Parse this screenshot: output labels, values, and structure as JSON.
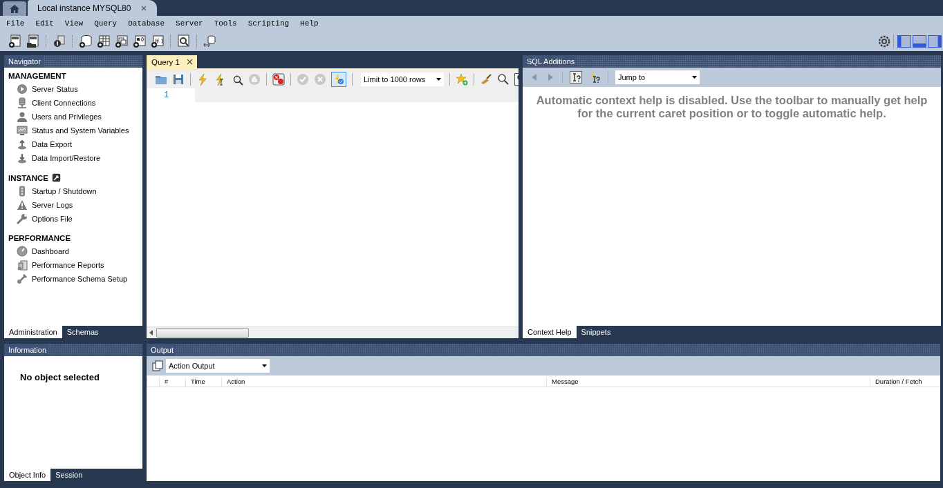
{
  "connection_tabs": [
    {
      "label": "Local instance MYSQL80",
      "selected": true
    }
  ],
  "menu": [
    "File",
    "Edit",
    "View",
    "Query",
    "Database",
    "Server",
    "Tools",
    "Scripting",
    "Help"
  ],
  "navigator": {
    "title": "Navigator",
    "sections": [
      {
        "heading": "MANAGEMENT",
        "items": [
          "Server Status",
          "Client Connections",
          "Users and Privileges",
          "Status and System Variables",
          "Data Export",
          "Data Import/Restore"
        ]
      },
      {
        "heading": "INSTANCE",
        "items": [
          "Startup / Shutdown",
          "Server Logs",
          "Options File"
        ]
      },
      {
        "heading": "PERFORMANCE",
        "items": [
          "Dashboard",
          "Performance Reports",
          "Performance Schema Setup"
        ]
      }
    ],
    "tabs": [
      {
        "label": "Administration",
        "selected": true
      },
      {
        "label": "Schemas",
        "selected": false
      }
    ]
  },
  "query_editor": {
    "tabs": [
      {
        "label": "Query 1",
        "selected": true
      }
    ],
    "limit": "Limit to 1000 rows",
    "line_numbers": [
      "1"
    ]
  },
  "sql_additions": {
    "title": "SQL Additions",
    "jump_to": "Jump to",
    "message": "Automatic context help is disabled. Use the toolbar to manually get help for the current caret position or to toggle automatic help.",
    "tabs": [
      {
        "label": "Context Help",
        "selected": true
      },
      {
        "label": "Snippets",
        "selected": false
      }
    ]
  },
  "information": {
    "title": "Information",
    "message": "No object selected",
    "tabs": [
      {
        "label": "Object Info",
        "selected": true
      },
      {
        "label": "Session",
        "selected": false
      }
    ]
  },
  "output": {
    "title": "Output",
    "mode": "Action Output",
    "columns": [
      "#",
      "Time",
      "Action",
      "Message",
      "Duration / Fetch"
    ]
  }
}
